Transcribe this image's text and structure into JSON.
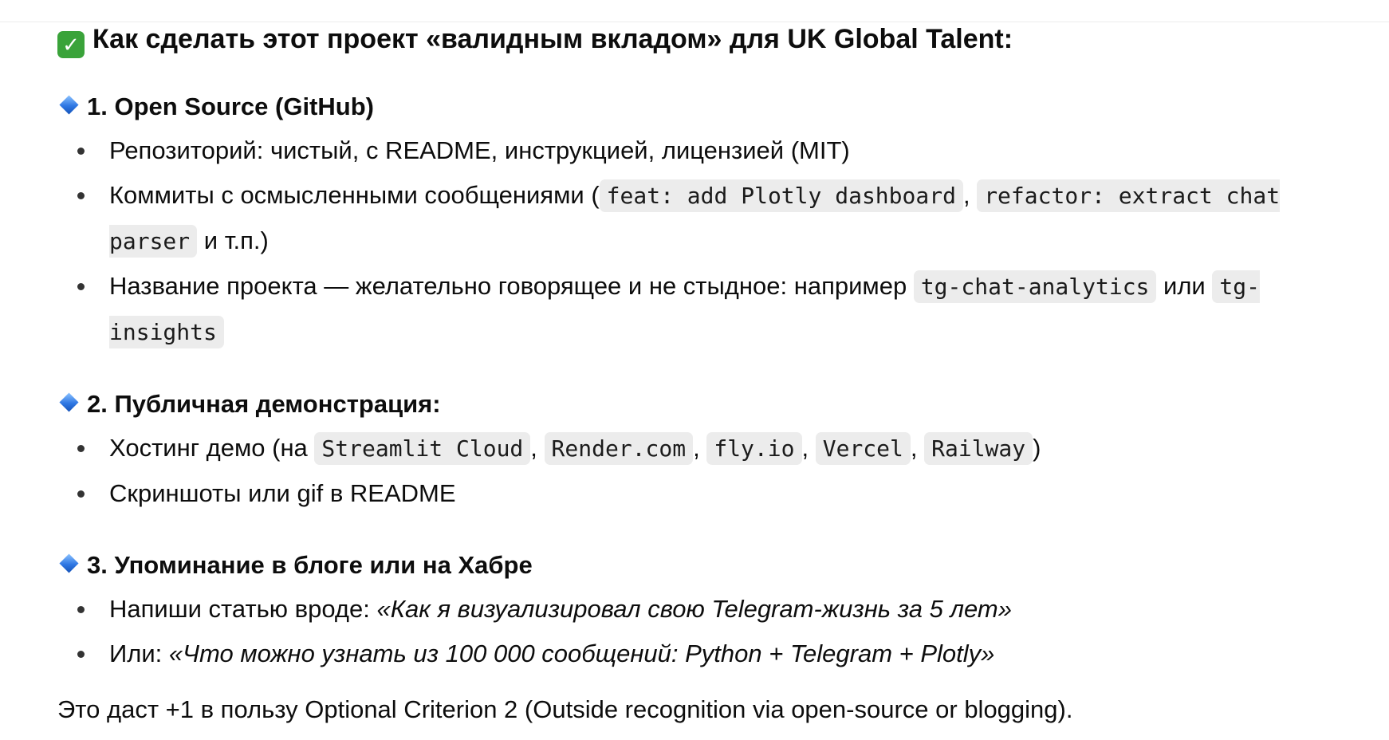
{
  "title": "Как сделать этот проект «валидным вкладом» для UK Global Talent:",
  "sections": [
    {
      "heading": "1. Open Source (GitHub)",
      "items": [
        {
          "text": "Репозиторий: чистый, с README, инструкцией, лицензией (MIT)"
        },
        {
          "t1": "Коммиты с осмысленными сообщениями (",
          "code1": "feat: add Plotly dashboard",
          "sep": ", ",
          "code2": "refactor: extract chat parser",
          "t2": " и т.п.)"
        },
        {
          "t1": "Название проекта — желательно говорящее и не стыдное: например ",
          "code1": "tg-chat-analytics",
          "t2": " или ",
          "code2": "tg-insights"
        }
      ]
    },
    {
      "heading": "2. Публичная демонстрация:",
      "items": [
        {
          "t1": "Хостинг демо (на ",
          "codes": [
            "Streamlit Cloud",
            "Render.com",
            "fly.io",
            "Vercel",
            "Railway"
          ],
          "sep": ", ",
          "t2": ")"
        },
        {
          "text": "Скриншоты или gif в README"
        }
      ]
    },
    {
      "heading": "3. Упоминание в блоге или на Хабре",
      "items": [
        {
          "t1": "Напиши статью вроде: ",
          "em": "«Как я визуализировал свою Telegram-жизнь за 5 лет»"
        },
        {
          "t1": "Или: ",
          "em": "«Что можно узнать из 100 000 сообщений: Python + Telegram + Plotly»"
        }
      ]
    }
  ],
  "footer": "Это даст +1 в пользу Optional Criterion 2 (Outside recognition via open-source or blogging).",
  "icons": {
    "title": "check-mark-button-icon",
    "section": "blue-diamond-icon"
  },
  "colors": {
    "code_bg": "#ececec",
    "check": "#3aa33a",
    "diamond": "#2f78e4"
  }
}
